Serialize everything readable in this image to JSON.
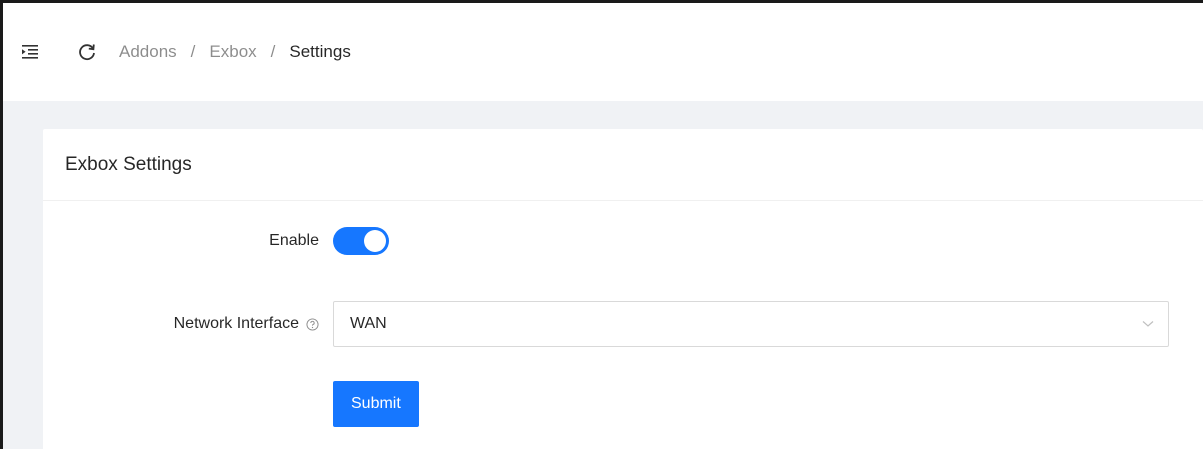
{
  "header": {
    "menu_icon": "menu-fold-icon",
    "reload_icon": "reload-icon",
    "breadcrumb": [
      "Addons",
      "Exbox",
      "Settings"
    ],
    "separator": "/"
  },
  "card": {
    "title": "Exbox Settings",
    "enable": {
      "label": "Enable",
      "checked": true
    },
    "network_interface": {
      "label": "Network Interface",
      "help_icon": "question-circle-icon",
      "value": "WAN"
    },
    "submit_label": "Submit"
  },
  "colors": {
    "primary": "#1677ff",
    "background": "#f0f2f5"
  }
}
